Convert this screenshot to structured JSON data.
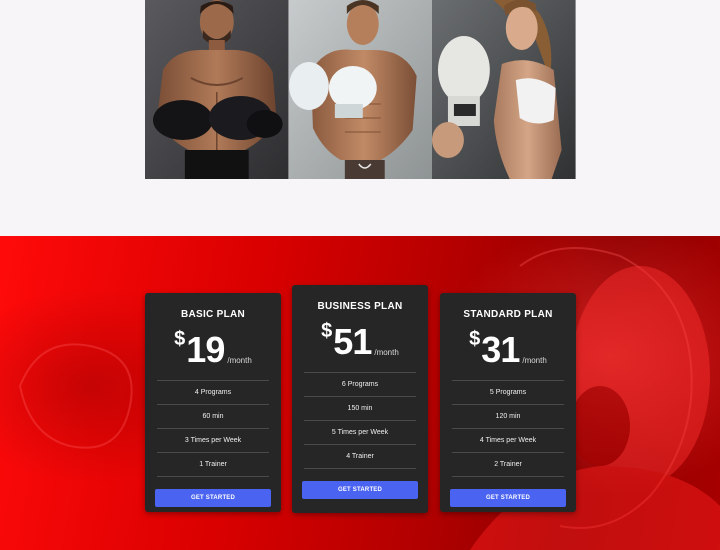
{
  "trainers": [
    {
      "photo": "trainer-photo-bearded-boxer"
    },
    {
      "photo": "trainer-photo-white-gloves-boxer"
    },
    {
      "photo": "trainer-photo-female-boxer"
    }
  ],
  "pricing": {
    "accent": "#e00000",
    "button_color": "#4a63f0",
    "plans": [
      {
        "name": "BASIC PLAN",
        "currency": "$",
        "amount": "19",
        "period": "/month",
        "features": [
          "4 Programs",
          "60 min",
          "3 Times per Week",
          "1 Trainer"
        ],
        "cta": "GET STARTED"
      },
      {
        "name": "BUSINESS PLAN",
        "currency": "$",
        "amount": "51",
        "period": "/month",
        "features": [
          "6 Programs",
          "150 min",
          "5 Times per Week",
          "4 Trainer"
        ],
        "cta": "GET STARTED"
      },
      {
        "name": "STANDARD PLAN",
        "currency": "$",
        "amount": "31",
        "period": "/month",
        "features": [
          "5 Programs",
          "120 min",
          "4 Times per Week",
          "2 Trainer"
        ],
        "cta": "GET STARTED"
      }
    ]
  }
}
